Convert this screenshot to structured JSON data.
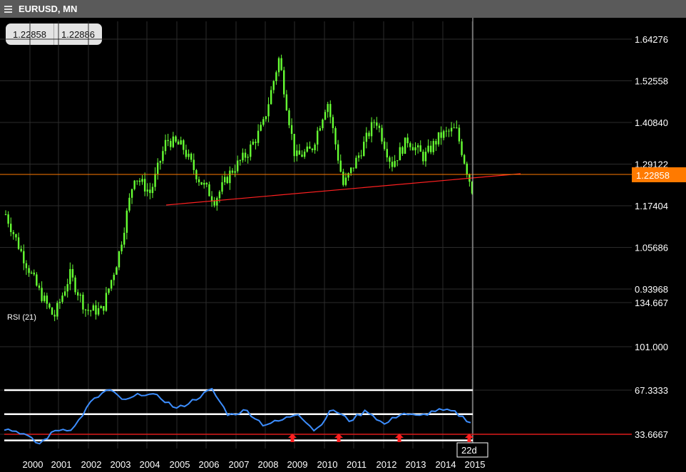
{
  "header": {
    "title": "EURUSD, MN"
  },
  "quote": {
    "bid": "1.22858",
    "ask": "1.22886"
  },
  "price_panel": {
    "y_ticks": [
      "1.64276",
      "1.52558",
      "1.40840",
      "1.29122",
      "1.17404",
      "1.05686",
      "0.93968"
    ],
    "current_price_label": "1.22858"
  },
  "rsi_panel": {
    "label": "RSI (21)",
    "y_ticks": [
      "134.667",
      "101.000",
      "67.3333",
      "33.6667"
    ],
    "crosshair_label": "22d"
  },
  "x_axis": {
    "labels": [
      "2000",
      "2001",
      "2002",
      "2003",
      "2004",
      "2005",
      "2006",
      "2007",
      "2008",
      "2009",
      "2010",
      "2011",
      "2012",
      "2013",
      "2014",
      "2015"
    ]
  },
  "colors": {
    "candles": "#66ff33",
    "rsi_line": "#3d8eff",
    "trendline": "#ff2020",
    "price_line": "#ff7a00",
    "signal_arrow": "#ff2020"
  },
  "chart_data": {
    "type": "line",
    "series": [
      {
        "values": [
          1.15,
          1.04,
          0.94,
          0.86,
          0.98,
          0.88,
          0.88,
          1.03,
          1.26,
          1.21,
          1.36,
          1.34,
          1.25,
          1.19,
          1.27,
          1.32,
          1.4,
          1.59,
          1.31,
          1.33,
          1.47,
          1.23,
          1.32,
          1.42,
          1.29,
          1.36,
          1.31,
          1.37,
          1.39,
          1.22
        ]
      },
      {
        "values": [
          38,
          35,
          26,
          37,
          38,
          58,
          68,
          59,
          65,
          62,
          53,
          60,
          68,
          48,
          52,
          41,
          44,
          50,
          36,
          53,
          44,
          52,
          41,
          50,
          47,
          52,
          51,
          43
        ]
      }
    ],
    "rsi_reference_levels": [
      67.3333,
      49,
      33.6667,
      29
    ],
    "signals": [
      "buy-arrow",
      "buy-arrow",
      "buy-arrow",
      "buy-arrow"
    ]
  }
}
